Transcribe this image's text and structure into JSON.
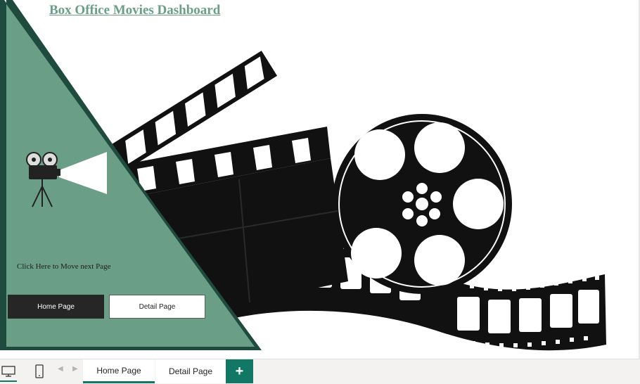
{
  "report": {
    "title": "Box Office Movies Dashboard",
    "click_text": "Click Here to Move next Page",
    "buttons": {
      "home": "Home Page",
      "detail": "Detail Page"
    }
  },
  "tabs": {
    "items": [
      {
        "label": "Home Page",
        "active": true
      },
      {
        "label": "Detail Page",
        "active": false
      }
    ],
    "add_label": "+"
  },
  "icons": {
    "desktop": "desktop-icon",
    "phone": "phone-icon",
    "prev": "chevron-left-icon",
    "next": "chevron-right-icon",
    "projector": "movie-projector-icon",
    "clapper": "clapperboard-icon",
    "reel": "film-reel-icon"
  },
  "colors": {
    "panel": "#6b9e87",
    "panel_shadow": "#1f4a3e",
    "title": "#6b9e87",
    "accent": "#117865",
    "dark_button": "#262626"
  }
}
